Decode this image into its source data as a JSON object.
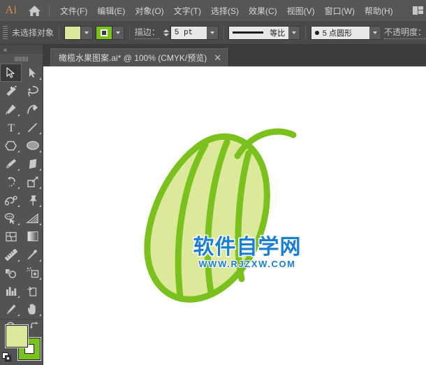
{
  "app": {
    "logo_text": "Ai",
    "home_icon": "home-icon",
    "workspace_icon": "workspace-switcher-icon"
  },
  "menubar": {
    "items": [
      {
        "label": "文件(F)",
        "name": "menu-file"
      },
      {
        "label": "编辑(E)",
        "name": "menu-edit"
      },
      {
        "label": "对象(O)",
        "name": "menu-object"
      },
      {
        "label": "文字(T)",
        "name": "menu-type"
      },
      {
        "label": "选择(S)",
        "name": "menu-select"
      },
      {
        "label": "效果(C)",
        "name": "menu-effect"
      },
      {
        "label": "视图(V)",
        "name": "menu-view"
      },
      {
        "label": "窗口(W)",
        "name": "menu-window"
      },
      {
        "label": "帮助(H)",
        "name": "menu-help"
      }
    ]
  },
  "optionsbar": {
    "selection_status": "未选择对象",
    "fill_color": "#dce89a",
    "stroke_color": "#7ac11e",
    "stroke_label": "描边：",
    "stroke_weight": "5 pt",
    "profile_label": "等比",
    "brush_label": "5 点圆形",
    "opacity_label": "不透明度："
  },
  "tabbar": {
    "document_title": "橄榄水果图案.ai* @ 100% (CMYK/预览)",
    "close_glyph": "✕"
  },
  "toolbar": {
    "collapse_glyph": "«",
    "tools": [
      {
        "name": "selection-tool",
        "icon": "arrow-solid-icon",
        "active": true,
        "has_flyout": false
      },
      {
        "name": "direct-selection-tool",
        "icon": "arrow-filled-icon",
        "active": false,
        "has_flyout": true
      },
      {
        "name": "magic-wand-tool",
        "icon": "magic-wand-icon",
        "active": false,
        "has_flyout": false
      },
      {
        "name": "lasso-tool",
        "icon": "lasso-icon",
        "active": false,
        "has_flyout": false
      },
      {
        "name": "pen-tool",
        "icon": "pen-icon",
        "active": false,
        "has_flyout": true
      },
      {
        "name": "curvature-tool",
        "icon": "curvature-icon",
        "active": false,
        "has_flyout": false
      },
      {
        "name": "type-tool",
        "icon": "type-t-icon",
        "active": false,
        "has_flyout": true
      },
      {
        "name": "line-segment-tool",
        "icon": "line-diagonal-icon",
        "active": false,
        "has_flyout": true
      },
      {
        "name": "polygon-tool",
        "icon": "polygon-icon",
        "active": false,
        "has_flyout": true
      },
      {
        "name": "ellipse-tool",
        "icon": "ellipse-icon",
        "active": false,
        "has_flyout": true
      },
      {
        "name": "paintbrush-tool",
        "icon": "paintbrush-icon",
        "active": false,
        "has_flyout": true
      },
      {
        "name": "eraser-tool",
        "icon": "eraser-icon",
        "active": false,
        "has_flyout": true
      },
      {
        "name": "rotate-tool",
        "icon": "rotate-icon",
        "active": false,
        "has_flyout": true
      },
      {
        "name": "scale-tool",
        "icon": "scale-icon",
        "active": false,
        "has_flyout": true
      },
      {
        "name": "width-tool",
        "icon": "width-warp-icon",
        "active": false,
        "has_flyout": true
      },
      {
        "name": "free-transform-tool",
        "icon": "pushpin-icon",
        "active": false,
        "has_flyout": true
      },
      {
        "name": "shape-builder-tool",
        "icon": "shape-builder-icon",
        "active": false,
        "has_flyout": true
      },
      {
        "name": "perspective-grid-tool",
        "icon": "perspective-grid-icon",
        "active": false,
        "has_flyout": true
      },
      {
        "name": "mesh-tool",
        "icon": "mesh-icon",
        "active": false,
        "has_flyout": false
      },
      {
        "name": "gradient-tool",
        "icon": "gradient-icon",
        "active": false,
        "has_flyout": false
      },
      {
        "name": "measure-tool",
        "icon": "ruler-icon",
        "active": false,
        "has_flyout": true
      },
      {
        "name": "eyedropper-tool",
        "icon": "eyedropper-icon",
        "active": false,
        "has_flyout": true
      },
      {
        "name": "blend-tool",
        "icon": "blend-icon",
        "active": false,
        "has_flyout": false
      },
      {
        "name": "symbol-sprayer-tool",
        "icon": "symbol-sprayer-icon",
        "active": false,
        "has_flyout": true
      },
      {
        "name": "column-graph-tool",
        "icon": "bar-graph-icon",
        "active": false,
        "has_flyout": true
      },
      {
        "name": "artboard-tool",
        "icon": "artboard-icon",
        "active": false,
        "has_flyout": false
      },
      {
        "name": "slice-tool",
        "icon": "slice-knife-icon",
        "active": false,
        "has_flyout": true
      },
      {
        "name": "hand-tool",
        "icon": "hand-icon",
        "active": false,
        "has_flyout": true
      },
      {
        "name": "zoom-tool",
        "icon": "magnifier-icon",
        "active": false,
        "has_flyout": false
      }
    ],
    "fill_color": "#dce89a",
    "stroke_color": "#7ac11e",
    "swap_icon": "swap-fill-stroke-icon",
    "default_icon": "default-fill-stroke-icon"
  },
  "artwork": {
    "title": "olive-fruit-illustration",
    "fill_color": "#dce89a",
    "stroke_color": "#7ac11e",
    "stroke_width": 9,
    "watermark_main": "软件自学网",
    "watermark_sub": "WWW.RJZXW.COM",
    "watermark_color": "#1a7fd4"
  }
}
